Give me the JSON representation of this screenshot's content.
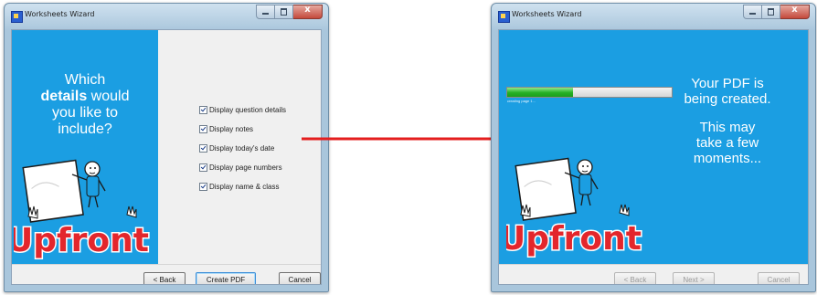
{
  "left_window": {
    "title": "Worksheets Wizard",
    "question_line1": "Which",
    "question_bold": "details",
    "question_line2_rest": " would",
    "question_line3": "you like to",
    "question_line4": "include?",
    "options": [
      {
        "label": "Display question details",
        "checked": true
      },
      {
        "label": "Display notes",
        "checked": true
      },
      {
        "label": "Display today's date",
        "checked": true
      },
      {
        "label": "Display page numbers",
        "checked": true
      },
      {
        "label": "Display name & class",
        "checked": true
      }
    ],
    "buttons": {
      "back": "< Back",
      "create": "Create PDF",
      "cancel": "Cancel"
    }
  },
  "right_window": {
    "title": "Worksheets Wizard",
    "progress_fraction": 0.4,
    "progress_text": "creating page 1...",
    "message1_line1": "Your PDF is",
    "message1_line2": "being created.",
    "message2_line1": "This may",
    "message2_line2": "take a few",
    "message2_line3": "moments...",
    "buttons": {
      "back": "< Back",
      "next": "Next >",
      "cancel": "Cancel"
    }
  },
  "logo_text": "Upfront",
  "colors": {
    "panel_blue": "#1b9ee2",
    "arrow_red": "#e41e1e",
    "logo_red": "#e3262c"
  }
}
